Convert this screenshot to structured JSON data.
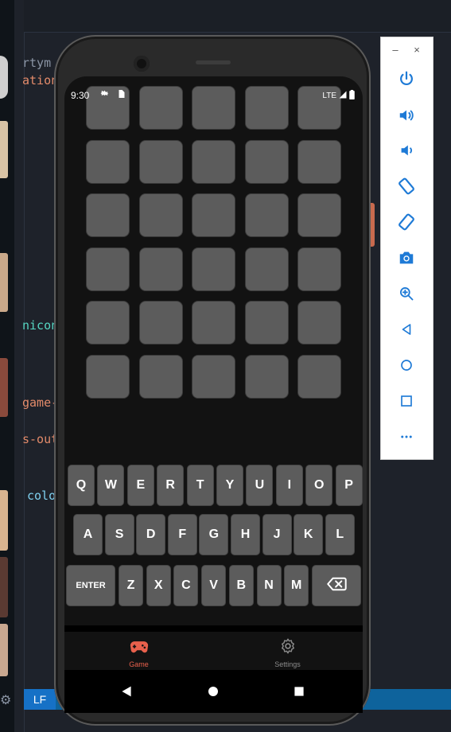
{
  "ide": {
    "code_fragments": [
      {
        "text": "rtym",
        "color": "#8b95a5"
      },
      {
        "text": "ation",
        "color": "#e38b6a"
      },
      {
        "text": "nicon",
        "color": "#56d6c2"
      },
      {
        "text": "game-",
        "color": "#e38b6a"
      },
      {
        "text": "s-out",
        "color": "#e38b6a"
      },
      {
        "text": "colo",
        "color": "#7fd1f0"
      }
    ],
    "status_encoding": "LF",
    "status_color": "#1671c6"
  },
  "emulator_panel": {
    "window_controls": [
      "–",
      "×"
    ],
    "buttons": [
      "power-icon",
      "volume-up-icon",
      "volume-down-icon",
      "rotate-left-icon",
      "rotate-right-icon",
      "camera-icon",
      "zoom-icon",
      "back-icon",
      "home-icon",
      "overview-icon",
      "more-icon"
    ],
    "icon_color": "#1e7ad6"
  },
  "phone": {
    "status_bar": {
      "time": "9:30",
      "network": "LTE"
    },
    "board": {
      "rows": 6,
      "cols": 5,
      "tile_color": "#5c5c5c"
    },
    "keyboard": {
      "row1": [
        "Q",
        "W",
        "E",
        "R",
        "T",
        "Y",
        "U",
        "I",
        "O",
        "P"
      ],
      "row2": [
        "A",
        "S",
        "D",
        "F",
        "G",
        "H",
        "J",
        "K",
        "L"
      ],
      "row3": [
        "ENTER",
        "Z",
        "X",
        "C",
        "V",
        "B",
        "N",
        "M"
      ],
      "backspace_icon": "backspace-icon"
    },
    "bottom_nav": {
      "items": [
        {
          "label": "Game",
          "icon": "gamepad-icon",
          "active": true
        },
        {
          "label": "Settings",
          "icon": "gear-icon",
          "active": false
        }
      ],
      "active_color": "#e8604c",
      "inactive_color": "#8a8a8a"
    },
    "android_nav": [
      "back-icon",
      "home-icon",
      "recents-icon"
    ]
  }
}
